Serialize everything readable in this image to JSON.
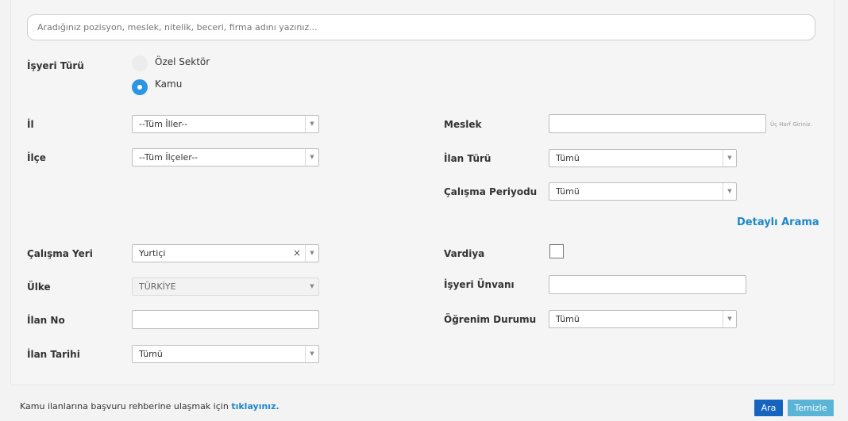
{
  "search": {
    "placeholder": "Aradığınız pozisyon, meslek, nitelik, beceri, firma adını yazınız..."
  },
  "employer_type": {
    "label": "İşyeri Türü",
    "options": [
      {
        "label": "Özel Sektör",
        "selected": false
      },
      {
        "label": "Kamu",
        "selected": true
      }
    ]
  },
  "left_fields": {
    "il": {
      "label": "İl",
      "value": "--Tüm İller--"
    },
    "ilce": {
      "label": "İlçe",
      "value": "--Tüm İlçeler--"
    },
    "calisma_yeri": {
      "label": "Çalışma Yeri",
      "value": "Yurtiçi",
      "clear_icon": "×"
    },
    "ulke": {
      "label": "Ülke",
      "value": "TÜRKİYE"
    },
    "ilan_no": {
      "label": "İlan No",
      "value": ""
    },
    "ilan_tarihi": {
      "label": "İlan Tarihi",
      "value": "Tümü"
    }
  },
  "right_fields": {
    "meslek": {
      "label": "Meslek",
      "value": "",
      "hint": "Üç Harf Giriniz."
    },
    "ilan_turu": {
      "label": "İlan Türü",
      "value": "Tümü"
    },
    "calisma_periyodu": {
      "label": "Çalışma Periyodu",
      "value": "Tümü"
    },
    "vardiya": {
      "label": "Vardiya",
      "checked": false
    },
    "isyeri_unvani": {
      "label": "İşyeri Ünvanı",
      "value": ""
    },
    "ogrenim_durumu": {
      "label": "Öğrenim Durumu",
      "value": "Tümü"
    }
  },
  "detailed_search": "Detaylı Arama",
  "footer": {
    "text": "Kamu ilanlarına başvuru rehberine ulaşmak için",
    "link": "tıklayınız.",
    "search_button": "Ara",
    "clear_button": "Temizle"
  },
  "colors": {
    "accent": "#1e87c8",
    "radio_on": "#2b95e6",
    "primary_button": "#1565c0",
    "secondary_button": "#5ab4d6"
  },
  "icons": {
    "select_arrow": "chevron-down-icon",
    "radio_dot": "radio-selected-icon"
  }
}
